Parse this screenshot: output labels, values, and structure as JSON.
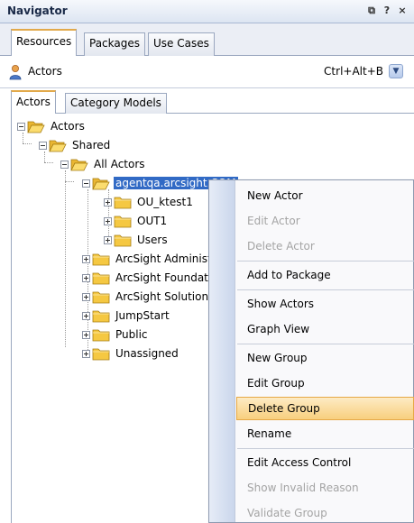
{
  "navigator": {
    "title": "Navigator",
    "controls": [
      "⧉",
      "?",
      "×"
    ]
  },
  "main_tabs": [
    {
      "label": "Resources",
      "active": true
    },
    {
      "label": "Packages",
      "active": false
    },
    {
      "label": "Use Cases",
      "active": false
    }
  ],
  "selector": {
    "value": "Actors",
    "shortcut": "Ctrl+Alt+B"
  },
  "inner_tabs": [
    {
      "label": "Actors",
      "active": true
    },
    {
      "label": "Category Models",
      "active": false
    }
  ],
  "tree": [
    {
      "label": "Actors",
      "open": true
    },
    {
      "label": "Shared",
      "open": true
    },
    {
      "label": "All Actors",
      "open": true
    },
    {
      "label": "agentqa.arcsight.COM",
      "open": true,
      "selected": true
    },
    {
      "label": "OU_ktest1",
      "open": false
    },
    {
      "label": "OUT1",
      "open": false
    },
    {
      "label": "Users",
      "open": false
    },
    {
      "label": "ArcSight Administration",
      "open": false
    },
    {
      "label": "ArcSight Foundation",
      "open": false
    },
    {
      "label": "ArcSight Solutions",
      "open": false
    },
    {
      "label": "JumpStart",
      "open": false
    },
    {
      "label": "Public",
      "open": false
    },
    {
      "label": "Unassigned",
      "open": false
    }
  ],
  "context_menu": [
    {
      "label": "New Actor",
      "enabled": true
    },
    {
      "label": "Edit Actor",
      "enabled": false
    },
    {
      "label": "Delete Actor",
      "enabled": false
    },
    {
      "label": "Add to Package",
      "enabled": true
    },
    {
      "label": "Show Actors",
      "enabled": true
    },
    {
      "label": "Graph View",
      "enabled": true
    },
    {
      "label": "New Group",
      "enabled": true
    },
    {
      "label": "Edit Group",
      "enabled": true
    },
    {
      "label": "Delete Group",
      "enabled": true,
      "highlighted": true
    },
    {
      "label": "Rename",
      "enabled": true
    },
    {
      "label": "Edit Access Control",
      "enabled": true
    },
    {
      "label": "Show Invalid Reason",
      "enabled": false
    },
    {
      "label": "Validate Group",
      "enabled": false
    }
  ],
  "colors": {
    "selection": "#316ac5",
    "menu_highlight": "#f8cf7e",
    "tab_accent": "#e2a94a",
    "folder": "#f5c842"
  }
}
